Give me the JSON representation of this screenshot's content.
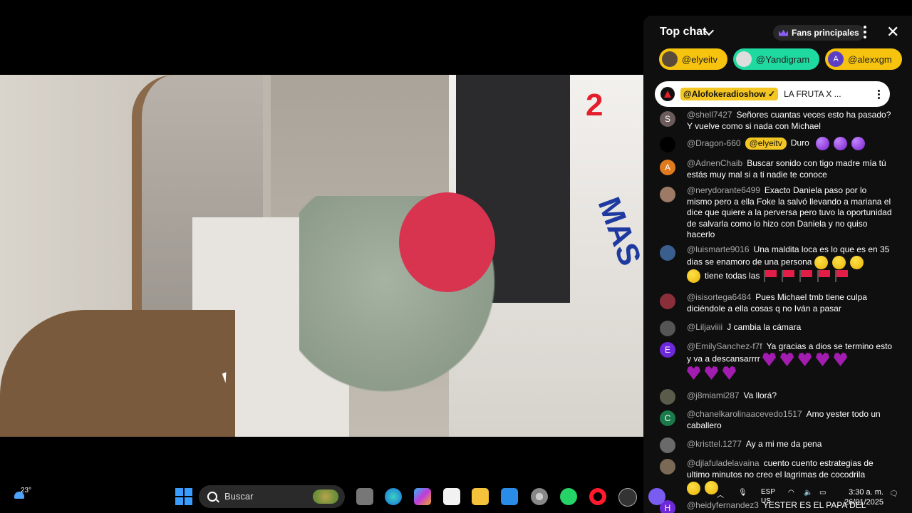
{
  "chat": {
    "title": "Top chat",
    "fans_label": "Fans principales",
    "pills": [
      {
        "name": "@elyeitv",
        "color": "#f6c30f"
      },
      {
        "name": "@Yandigram",
        "color": "#1ed9a0"
      },
      {
        "name": "@alexxgm",
        "avatar_letter": "A",
        "color": "#f6c30f"
      }
    ],
    "pinned": {
      "user": "@Alofokeradioshow",
      "text": "LA FRUTA X ..."
    },
    "messages": [
      {
        "author": "@shell7427",
        "avatar": "S",
        "avatar_color": "#6b5b5b",
        "text": "Señores cuantas veces esto ha pasado? Y vuelve como si nada con Michael"
      },
      {
        "author": "@Dragon-660",
        "avatar": "",
        "avatar_color": "#000000",
        "badge": "@elyeitv",
        "text": "Duro"
      },
      {
        "author": "@AdnenChaib",
        "avatar": "A",
        "avatar_color": "#e07a1f",
        "text": "Buscar sonido con tigo madre mía tú estás muy mal si a ti nadie te conoce"
      },
      {
        "author": "@nerydorante6499",
        "avatar": "",
        "avatar_color": "#9c7a66",
        "text": "Exacto Daniela paso por lo mismo pero a ella Foke la salvó llevando a mariana el dice que quiere a la perversa pero tuvo la oportunidad de salvarla como lo hizo con Daniela y no quiso hacerlo"
      },
      {
        "author": "@luismarte9016",
        "avatar": "",
        "avatar_color": "#3a5f8c",
        "text": "Una maldita loca es lo que es en 35 dias se enamoro de una persona",
        "text2": "tiene todas las"
      },
      {
        "author": "@isisortega6484",
        "avatar": "",
        "avatar_color": "#8a2f3a",
        "text": "Pues Michael tmb tiene culpa diciéndole a ella cosas q no Iván a pasar"
      },
      {
        "author": "@Liljaviiii",
        "avatar": "",
        "avatar_color": "#555555",
        "text": "J cambia la cámara"
      },
      {
        "author": "@EmilySanchez-f7f",
        "avatar": "E",
        "avatar_color": "#6d28d9",
        "text": "Ya gracias a dios se termino esto y va a descansarrrr"
      },
      {
        "author": "@j8miami287",
        "avatar": "",
        "avatar_color": "#5b5b4b",
        "text": "Va llorá?"
      },
      {
        "author": "@chanelkarolinaacevedo1517",
        "avatar": "C",
        "avatar_color": "#1a7a4a",
        "text": "Amo yester todo un caballero"
      },
      {
        "author": "@kristtel.1277",
        "avatar": "",
        "avatar_color": "#6a6a6a",
        "text": "Ay a mi me da pena"
      },
      {
        "author": "@djlafuladelavaina",
        "avatar": "",
        "avatar_color": "#7a6a55",
        "text": "cuento cuento estrategias de ultimo minutos no creo el lagrimas de cocodrila"
      },
      {
        "author": "@heidyfernandez3",
        "avatar": "H",
        "avatar_color": "#6d28d9",
        "text": "YESTER ES EL PAPA DEL"
      }
    ]
  },
  "taskbar": {
    "weather_temp": "23°",
    "search_placeholder": "Buscar",
    "lang_top": "ESP",
    "lang_bottom": "US",
    "time": "3:30 a. m.",
    "date": "26/01/2025"
  }
}
